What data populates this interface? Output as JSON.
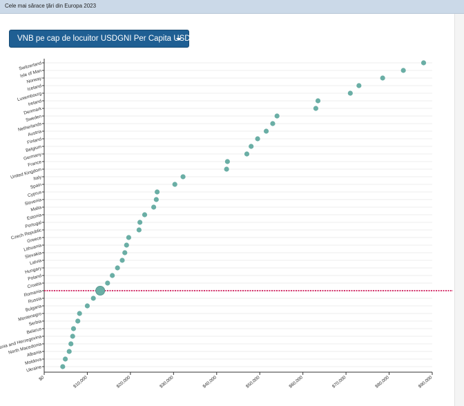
{
  "header": {
    "title": "Cele mai sărace țări din Europa 2023"
  },
  "selector": {
    "label": "VNB pe cap de locuitor USDGNI Per Capita USD"
  },
  "icons": {
    "selector_caret": "caret-down-icon"
  },
  "colors": {
    "point": "#6aaea5",
    "highlight": "#6aaea5",
    "highlight_line": "#d6336c",
    "grid": "#eeeeee",
    "selector_bg": "#1f5f93"
  },
  "chart_data": {
    "type": "scatter",
    "title": "",
    "xlabel": "",
    "ylabel": "",
    "xlim": [
      0,
      90000
    ],
    "x_ticks": [
      0,
      10000,
      20000,
      30000,
      40000,
      50000,
      60000,
      70000,
      80000,
      90000
    ],
    "x_tick_labels": [
      "$0",
      "$10,000",
      "$20,000",
      "$30,000",
      "$40,000",
      "$50,000",
      "$60,000",
      "$70,000",
      "$80,000",
      "$90,000"
    ],
    "grid": true,
    "highlight": "Romania",
    "categories": [
      "Switzerland",
      "Isle of Man",
      "Norway",
      "Iceland",
      "Luxembourg",
      "Ireland",
      "Denmark",
      "Sweden",
      "Netherlands",
      "Austria",
      "Finland",
      "Belgium",
      "Germany",
      "France",
      "United Kingdom",
      "Italy",
      "Spain",
      "Cyprus",
      "Slovenia",
      "Malta",
      "Estonia",
      "Portugal",
      "Czech Republic",
      "Greece",
      "Lithuania",
      "Slovakia",
      "Latvia",
      "Hungary",
      "Poland",
      "Croatia",
      "Romania",
      "Russia",
      "Bulgaria",
      "Montenegro",
      "Serbia",
      "Belarus",
      "Bosnia and Herzegovina",
      "North Macedonia",
      "Albania",
      "Moldova",
      "Ukraine"
    ],
    "values": [
      88000,
      83300,
      78500,
      73000,
      71000,
      63500,
      63000,
      54000,
      53000,
      51500,
      49500,
      48000,
      47000,
      42500,
      42300,
      32200,
      30300,
      26200,
      26000,
      25400,
      23300,
      22200,
      22000,
      19600,
      19100,
      18700,
      18100,
      17000,
      15800,
      14700,
      13000,
      11400,
      10000,
      8200,
      7800,
      6800,
      6600,
      6200,
      5800,
      4900,
      4300
    ]
  }
}
